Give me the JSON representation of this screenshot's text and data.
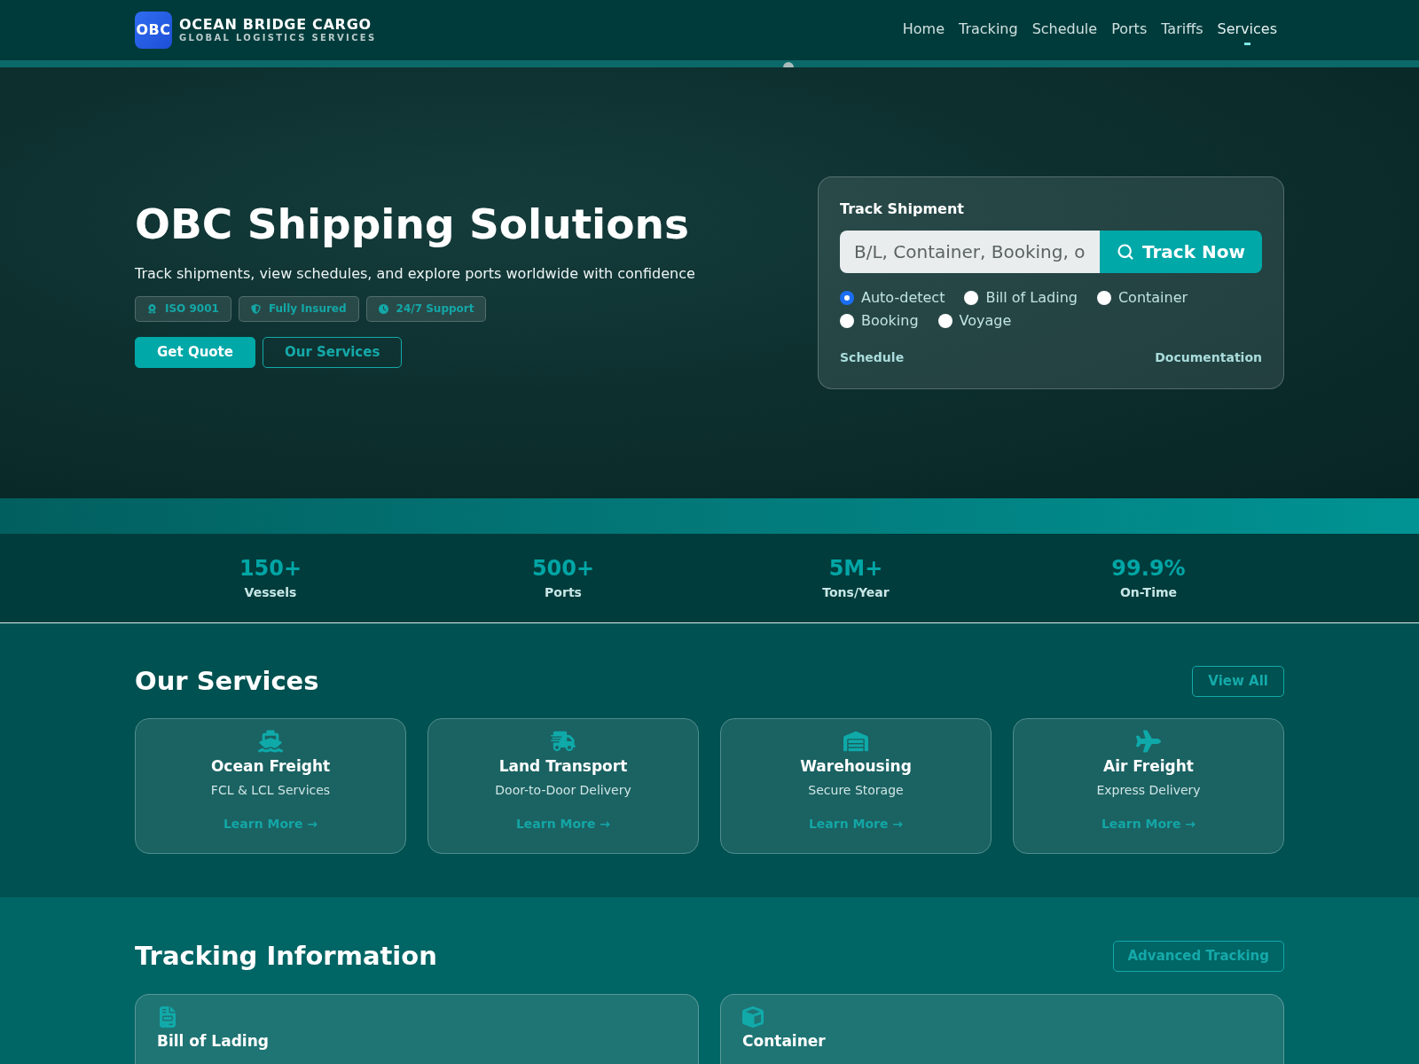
{
  "header": {
    "logo": {
      "mark": "OBC",
      "name": "OCEAN BRIDGE CARGO",
      "tagline": "GLOBAL LOGISTICS SERVICES"
    },
    "nav": [
      {
        "label": "Home",
        "selected": false
      },
      {
        "label": "Tracking",
        "selected": false
      },
      {
        "label": "Schedule",
        "selected": false
      },
      {
        "label": "Ports",
        "selected": false
      },
      {
        "label": "Tariffs",
        "selected": false
      },
      {
        "label": "Services",
        "selected": true
      }
    ]
  },
  "hero": {
    "title": "OBC Shipping Solutions",
    "subtitle": "Track shipments, view schedules, and explore ports worldwide with confidence",
    "badges": [
      "ISO 9001",
      "Fully Insured",
      "24/7 Support"
    ],
    "buttons": [
      {
        "kind": "primary",
        "label": "Get Quote"
      },
      {
        "kind": "outline",
        "label": "Our Services"
      }
    ]
  },
  "track_card": {
    "title": "Track Shipment",
    "search": {
      "placeholder": "B/L, Container, Booking, o"
    },
    "button": "Track Now",
    "options": [
      {
        "label": "Auto-detect",
        "selected": true
      },
      {
        "label": "Bill of Lading",
        "selected": false
      },
      {
        "label": "Container",
        "selected": false
      },
      {
        "label": "Booking",
        "selected": false
      },
      {
        "label": "Voyage",
        "selected": false
      }
    ],
    "links": [
      "Schedule",
      "Documentation"
    ]
  },
  "stats": [
    {
      "value": "150+",
      "label": "Vessels"
    },
    {
      "value": "500+",
      "label": "Ports"
    },
    {
      "value": "5M+",
      "label": "Tons/Year"
    },
    {
      "value": "99.9%",
      "label": "On-Time"
    }
  ],
  "services": {
    "title": "Our Services",
    "button": "View All",
    "cards": [
      {
        "title": "Ocean Freight",
        "subtitle": "FCL & LCL Services",
        "link": "Learn More →"
      },
      {
        "title": "Land Transport",
        "subtitle": "Door-to-Door Delivery",
        "link": "Learn More →"
      },
      {
        "title": "Warehousing",
        "subtitle": "Secure Storage",
        "link": "Learn More →"
      },
      {
        "title": "Air Freight",
        "subtitle": "Express Delivery",
        "link": "Learn More →"
      }
    ]
  },
  "tracking": {
    "title": "Tracking Information",
    "button": "Advanced Tracking",
    "cards": [
      {
        "title": "Bill of Lading"
      },
      {
        "title": "Container"
      }
    ]
  }
}
